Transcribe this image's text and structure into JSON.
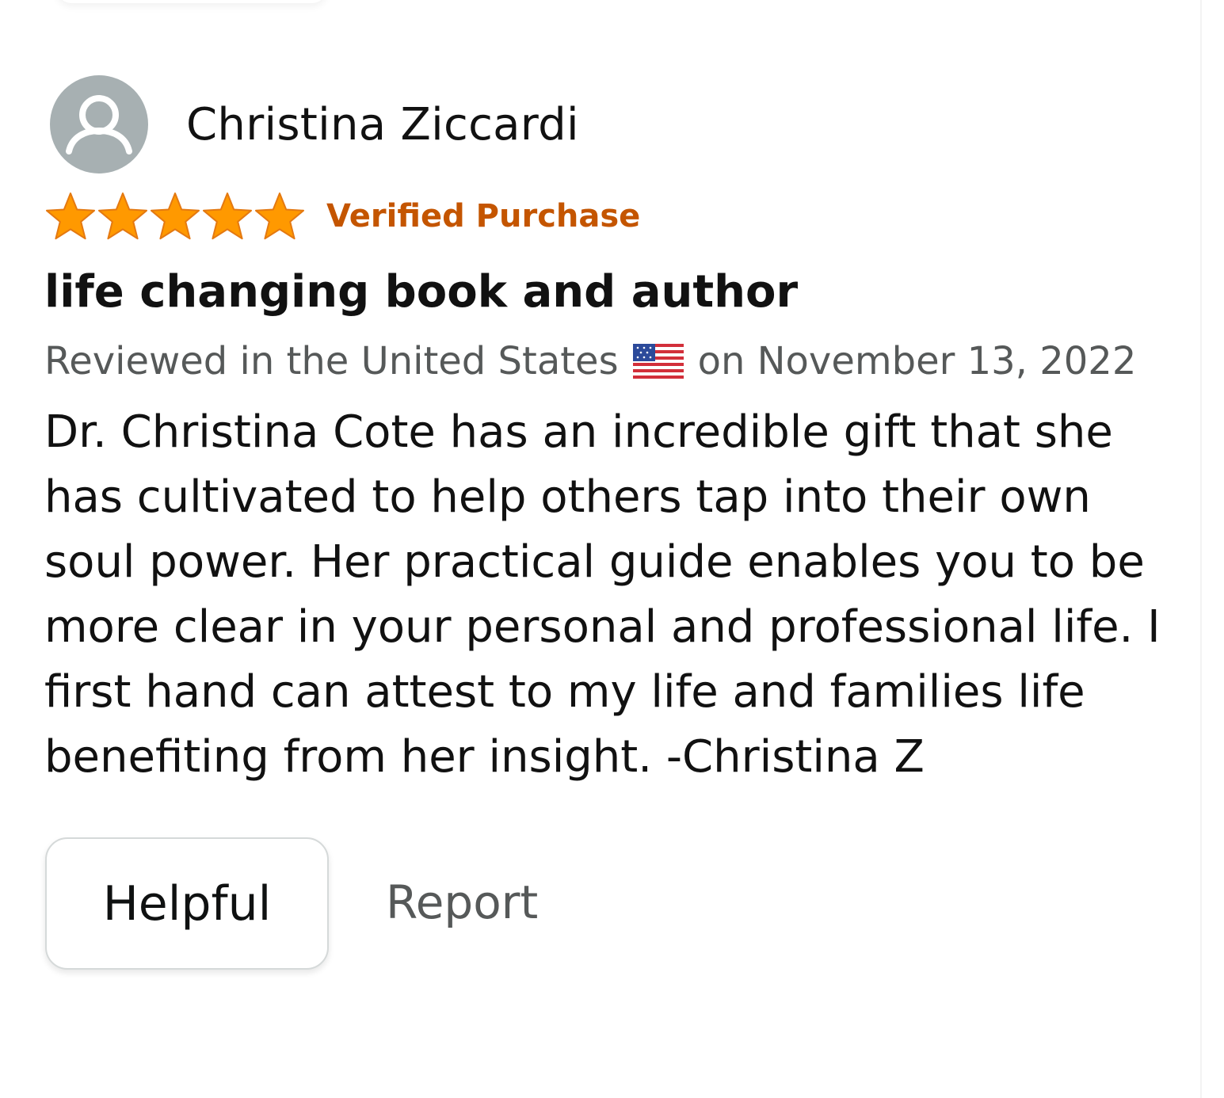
{
  "review": {
    "reviewer_name": "Christina Ziccardi",
    "avatar_icon": "user-silhouette-icon",
    "rating": 5,
    "rating_max": 5,
    "star_color": "#ff9900",
    "verified_label": "Verified Purchase",
    "verified_color": "#c45500",
    "title": "life changing book and author",
    "meta_prefix": "Reviewed in the United States",
    "meta_flag_icon": "us-flag-icon",
    "meta_suffix": "on November 13, 2022",
    "body": "Dr. Christina Cote has an incredible gift that she has cultivated to help others tap into their own soul power. Her practical guide enables you to be more clear in your personal and professional life. I first hand can attest to my life and families life benefiting from her insight. -Christina Z"
  },
  "actions": {
    "helpful_label": "Helpful",
    "report_label": "Report"
  }
}
